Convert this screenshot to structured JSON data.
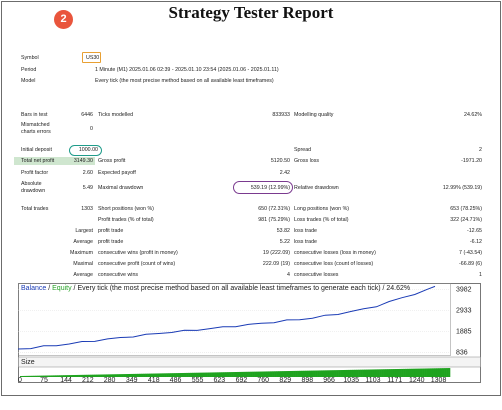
{
  "report": {
    "title": "Strategy Tester Report",
    "badge": "2"
  },
  "settings": {
    "symbol_label": "Symbol",
    "symbol_value": "US30",
    "period_label": "Period",
    "period_value": "1 Minute (M1) 2025.01.06 02:39 - 2025.01.10 23:54 (2025.01.06 - 2025.01.11)",
    "model_label": "Model",
    "model_value": "Every tick (the most precise method based on all available least timeframes)"
  },
  "results": {
    "bars_label": "Bars in test",
    "bars_value": "6446",
    "ticks_label": "Ticks modelled",
    "ticks_value": "833933",
    "quality_label": "Modelling quality",
    "quality_value": "24.62%",
    "mismatched_label_1": "Mismatched",
    "mismatched_label_2": "charts errors",
    "mismatched_value": "0",
    "deposit_label": "Initial deposit",
    "deposit_value": "1000.00",
    "spread_label": "Spread",
    "spread_value": "2",
    "net_profit_label": "Total net profit",
    "net_profit_value": "3149.30",
    "gross_profit_label": "Gross profit",
    "gross_profit_value": "5120.50",
    "gross_loss_label": "Gross loss",
    "gross_loss_value": "-1971.20",
    "profit_factor_label": "Profit factor",
    "profit_factor_value": "2.60",
    "expected_payoff_label": "Expected payoff",
    "expected_payoff_value": "2.42",
    "abs_dd_label_1": "Absolute",
    "abs_dd_label_2": "drawdown",
    "abs_dd_value": "5.49",
    "max_dd_label": "Maximal drawdown",
    "max_dd_value": "539.19 (12.99%)",
    "rel_dd_label": "Relative drawdown",
    "rel_dd_value": "12.99% (539.19)",
    "total_trades_label": "Total trades",
    "total_trades_value": "1303",
    "short_label": "Short positions (won %)",
    "short_value": "650 (72.31%)",
    "long_label": "Long positions (won %)",
    "long_value": "653 (78.25%)",
    "profit_trades_label": "Profit trades (% of total)",
    "profit_trades_value": "981 (75.29%)",
    "loss_trades_label": "Loss trades (% of total)",
    "loss_trades_value": "322 (24.71%)",
    "largest_label": "Largest",
    "largest_profit_label": "profit trade",
    "largest_profit_value": "53.82",
    "largest_loss_label": "loss trade",
    "largest_loss_value": "-12.65",
    "average_label": "Average",
    "avg_profit_label": "profit trade",
    "avg_profit_value": "5.22",
    "avg_loss_label": "loss trade",
    "avg_loss_value": "-6.12",
    "maximum_label": "Maximum",
    "max_consec_wins_label": "consecutive wins (profit in money)",
    "max_consec_wins_value": "19 (222.09)",
    "max_consec_losses_label": "consecutive losses (loss in money)",
    "max_consec_losses_value": "7 (-43.54)",
    "maximal_label": "Maximal",
    "maximal_profit_label": "consecutive profit (count of wins)",
    "maximal_profit_value": "222.09 (19)",
    "maximal_loss_label": "consecutive loss (count of losses)",
    "maximal_loss_value": "-66.89 (6)",
    "average2_label": "Average",
    "avg_consec_wins_label": "consecutive wins",
    "avg_consec_wins_value": "4",
    "avg_consec_losses_label": "consecutive losses",
    "avg_consec_losses_value": "1"
  },
  "chart_legend": {
    "balance": "Balance",
    "sep1": " / ",
    "equity": "Equity",
    "rest": " / Every tick (the most precise method based on all available least timeframes to generate each tick) / 24.62%",
    "size_label": "Size"
  },
  "colors": {
    "balance": "#1a3bb5",
    "equity": "#2aa52a",
    "size_bars": "#1fa31f"
  },
  "chart_data": {
    "type": "line",
    "title": "Balance / Equity / Every tick (the most precise method based on all available least timeframes to generate each tick) / 24.62%",
    "x_ticks": [
      0,
      75,
      144,
      212,
      280,
      349,
      418,
      486,
      555,
      623,
      692,
      760,
      829,
      898,
      966,
      1035,
      1103,
      1171,
      1240,
      1308
    ],
    "y_ticks": [
      836,
      1885,
      2933,
      3982
    ],
    "xlim": [
      0,
      1350
    ],
    "ylim": [
      700,
      4300
    ],
    "series": [
      {
        "name": "Balance",
        "x": [
          0,
          40,
          80,
          120,
          160,
          200,
          240,
          280,
          320,
          360,
          400,
          440,
          480,
          520,
          560,
          600,
          640,
          680,
          720,
          760,
          800,
          840,
          880,
          920,
          960,
          1000,
          1040,
          1080,
          1120,
          1160,
          1200,
          1240,
          1280,
          1303
        ],
        "values": [
          1000,
          1050,
          1120,
          1190,
          1260,
          1340,
          1420,
          1490,
          1560,
          1640,
          1700,
          1780,
          1850,
          1900,
          1960,
          2020,
          2080,
          2150,
          2210,
          2280,
          2350,
          2420,
          2480,
          2560,
          2650,
          2760,
          2870,
          2990,
          3150,
          3350,
          3560,
          3760,
          3950,
          4149
        ]
      }
    ],
    "size_panel": {
      "label": "Size",
      "description": "volume bars under equity chart"
    }
  }
}
